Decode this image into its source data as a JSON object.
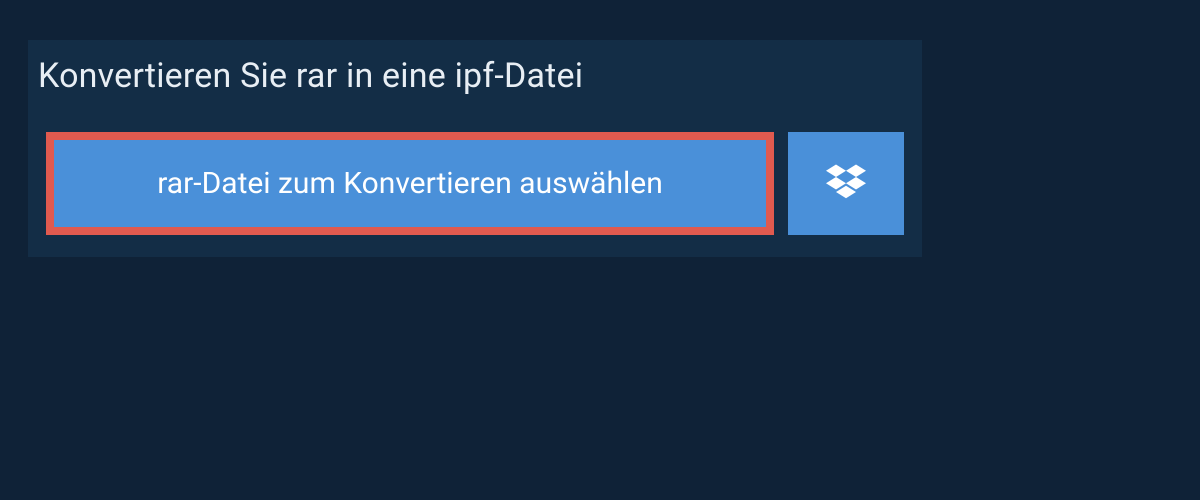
{
  "converter": {
    "heading": "Konvertieren Sie rar in eine ipf-Datei",
    "select_file_label": "rar-Datei zum Konvertieren auswählen"
  },
  "colors": {
    "page_bg": "#0f2237",
    "panel_bg": "#132d46",
    "button_bg": "#4a90d9",
    "button_border": "#e05a4f",
    "text_light": "#e8eef4",
    "text_white": "#ffffff"
  }
}
